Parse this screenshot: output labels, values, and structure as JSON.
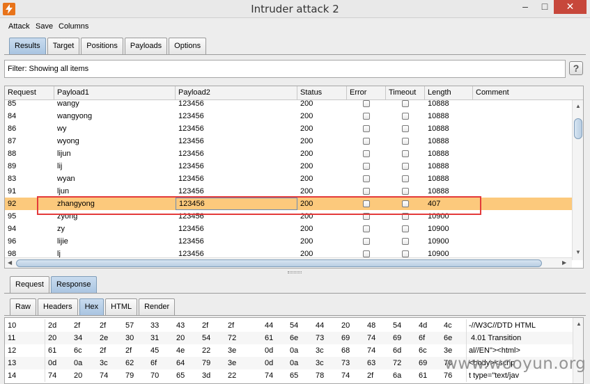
{
  "window": {
    "title": "Intruder attack 2",
    "minimize": "–",
    "maximize": "□",
    "close": "✕"
  },
  "menu": [
    "Attack",
    "Save",
    "Columns"
  ],
  "main_tabs": [
    {
      "label": "Results",
      "active": true
    },
    {
      "label": "Target",
      "active": false
    },
    {
      "label": "Positions",
      "active": false
    },
    {
      "label": "Payloads",
      "active": false
    },
    {
      "label": "Options",
      "active": false
    }
  ],
  "filter": {
    "text": "Filter:  Showing all items",
    "help_label": "?"
  },
  "columns": [
    "Request",
    "Payload1",
    "Payload2",
    "Status",
    "Error",
    "Timeout",
    "Length",
    "Comment"
  ],
  "rows": [
    {
      "request": "85",
      "payload1": "wangy",
      "payload2": "123456",
      "status": "200",
      "error": false,
      "timeout": false,
      "length": "10888",
      "comment": "",
      "selected": false
    },
    {
      "request": "84",
      "payload1": "wangyong",
      "payload2": "123456",
      "status": "200",
      "error": false,
      "timeout": false,
      "length": "10888",
      "comment": "",
      "selected": false
    },
    {
      "request": "86",
      "payload1": "wy",
      "payload2": "123456",
      "status": "200",
      "error": false,
      "timeout": false,
      "length": "10888",
      "comment": "",
      "selected": false
    },
    {
      "request": "87",
      "payload1": "wyong",
      "payload2": "123456",
      "status": "200",
      "error": false,
      "timeout": false,
      "length": "10888",
      "comment": "",
      "selected": false
    },
    {
      "request": "88",
      "payload1": "lijun",
      "payload2": "123456",
      "status": "200",
      "error": false,
      "timeout": false,
      "length": "10888",
      "comment": "",
      "selected": false
    },
    {
      "request": "89",
      "payload1": "lij",
      "payload2": "123456",
      "status": "200",
      "error": false,
      "timeout": false,
      "length": "10888",
      "comment": "",
      "selected": false
    },
    {
      "request": "83",
      "payload1": "wyan",
      "payload2": "123456",
      "status": "200",
      "error": false,
      "timeout": false,
      "length": "10888",
      "comment": "",
      "selected": false
    },
    {
      "request": "91",
      "payload1": "ljun",
      "payload2": "123456",
      "status": "200",
      "error": false,
      "timeout": false,
      "length": "10888",
      "comment": "",
      "selected": false
    },
    {
      "request": "92",
      "payload1": "zhangyong",
      "payload2": "123456",
      "status": "200",
      "error": false,
      "timeout": false,
      "length": "407",
      "comment": "",
      "selected": true
    },
    {
      "request": "95",
      "payload1": "zyong",
      "payload2": "123456",
      "status": "200",
      "error": false,
      "timeout": false,
      "length": "10900",
      "comment": "",
      "selected": false
    },
    {
      "request": "94",
      "payload1": "zy",
      "payload2": "123456",
      "status": "200",
      "error": false,
      "timeout": false,
      "length": "10900",
      "comment": "",
      "selected": false
    },
    {
      "request": "96",
      "payload1": "lijie",
      "payload2": "123456",
      "status": "200",
      "error": false,
      "timeout": false,
      "length": "10900",
      "comment": "",
      "selected": false
    },
    {
      "request": "98",
      "payload1": "lj",
      "payload2": "123456",
      "status": "200",
      "error": false,
      "timeout": false,
      "length": "10900",
      "comment": "",
      "selected": false
    }
  ],
  "message_tabs": [
    {
      "label": "Request",
      "active": false
    },
    {
      "label": "Response",
      "active": true
    }
  ],
  "view_tabs": [
    {
      "label": "Raw",
      "active": false
    },
    {
      "label": "Headers",
      "active": false
    },
    {
      "label": "Hex",
      "active": true
    },
    {
      "label": "HTML",
      "active": false
    },
    {
      "label": "Render",
      "active": false
    }
  ],
  "hex_rows": [
    {
      "offset": "10",
      "bytes": [
        "2d",
        "2f",
        "2f",
        "57",
        "33",
        "43",
        "2f",
        "2f",
        "44",
        "54",
        "44",
        "20",
        "48",
        "54",
        "4d",
        "4c"
      ],
      "ascii": "-//W3C//DTD HTML"
    },
    {
      "offset": "11",
      "bytes": [
        "20",
        "34",
        "2e",
        "30",
        "31",
        "20",
        "54",
        "72",
        "61",
        "6e",
        "73",
        "69",
        "74",
        "69",
        "6f",
        "6e"
      ],
      "ascii": " 4.01 Transition"
    },
    {
      "offset": "12",
      "bytes": [
        "61",
        "6c",
        "2f",
        "2f",
        "45",
        "4e",
        "22",
        "3e",
        "0d",
        "0a",
        "3c",
        "68",
        "74",
        "6d",
        "6c",
        "3e"
      ],
      "ascii": "al//EN\"><html>"
    },
    {
      "offset": "13",
      "bytes": [
        "0d",
        "0a",
        "3c",
        "62",
        "6f",
        "64",
        "79",
        "3e",
        "0d",
        "0a",
        "3c",
        "73",
        "63",
        "72",
        "69",
        "70"
      ],
      "ascii": "<body><scrip"
    },
    {
      "offset": "14",
      "bytes": [
        "74",
        "20",
        "74",
        "79",
        "70",
        "65",
        "3d",
        "22",
        "74",
        "65",
        "78",
        "74",
        "2f",
        "6a",
        "61",
        "76"
      ],
      "ascii": "t type=\"text/jav"
    }
  ],
  "watermark": "www.wooyun.org",
  "colors": {
    "selected_row": "#fcc97c",
    "highlight_box": "#e33a3a",
    "active_tab": "#a9c4e1",
    "close_button": "#c7473b"
  }
}
